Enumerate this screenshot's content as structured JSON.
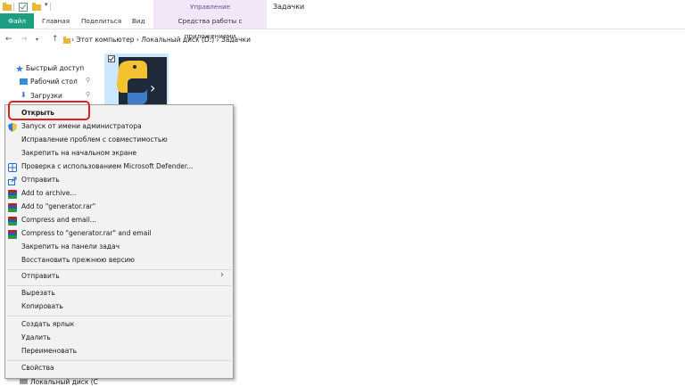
{
  "window": {
    "title": "Задачки",
    "context_header": "Управление"
  },
  "ribbon": {
    "tabs": [
      "Файл",
      "Главная",
      "Поделиться",
      "Вид",
      "Средства работы с приложениями"
    ]
  },
  "address": {
    "text": "›  Этот компьютер  ›  Локальный диск (D:)  ›  Задачки"
  },
  "nav_pane": {
    "items": [
      "Быстрый доступ",
      "Рабочий стол",
      "Загрузки",
      "Локальный диск (C"
    ]
  },
  "context_menu": {
    "items": [
      "Открыть",
      "Запуск от имени администратора",
      "Исправление проблем с совместимостью",
      "Закрепить на начальном экране",
      "Проверка с использованием Microsoft Defender...",
      "Отправить",
      "Add to archive...",
      "Add to \"generator.rar\"",
      "Compress and email...",
      "Compress to \"generator.rar\" and email",
      "Закрепить на панели задач",
      "Восстановить прежнюю версию",
      "Отправить",
      "Вырезать",
      "Копировать",
      "Создать ярлык",
      "Удалить",
      "Переименовать",
      "Свойства"
    ],
    "submenu_arrow": "›"
  },
  "colors": {
    "file_tab": "#1b9e82",
    "highlight": "#e02020",
    "selected_tile": "#cce8ff",
    "context_tab": "#f2e6f9"
  }
}
